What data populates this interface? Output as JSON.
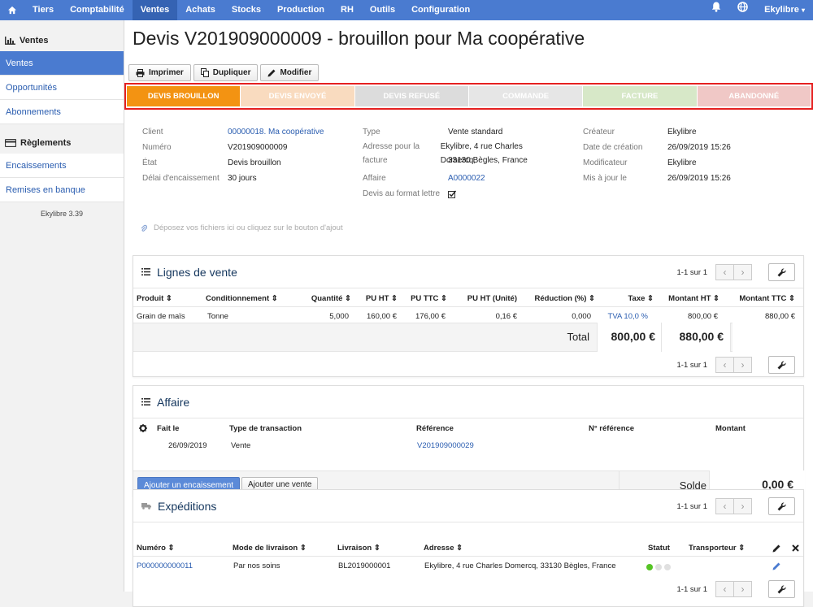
{
  "topbar": {
    "items": [
      "Tiers",
      "Comptabilité",
      "Ventes",
      "Achats",
      "Stocks",
      "Production",
      "RH",
      "Outils",
      "Configuration"
    ],
    "user": "Ekylibre"
  },
  "sidebar": {
    "section1": "Ventes",
    "items1": [
      "Ventes",
      "Opportunités",
      "Abonnements"
    ],
    "section2": "Règlements",
    "items2": [
      "Encaissements",
      "Remises en banque"
    ],
    "version": "Ekylibre 3.39"
  },
  "page": {
    "title": "Devis V201909000009 - brouillon pour Ma coopérative",
    "buttons": [
      "Imprimer",
      "Dupliquer",
      "Modifier"
    ]
  },
  "stages": [
    {
      "label": "DEVIS BROUILLON",
      "color": "#f39312"
    },
    {
      "label": "DEVIS ENVOYÉ",
      "color": "#f9dbbf"
    },
    {
      "label": "DEVIS REFUSÉ",
      "color": "#dcdcdc"
    },
    {
      "label": "COMMANDE",
      "color": "#e6e6e6"
    },
    {
      "label": "FACTURE",
      "color": "#d7e8c8"
    },
    {
      "label": "ABANDONNÉ",
      "color": "#f0c8c6"
    }
  ],
  "info": {
    "col1": [
      {
        "label": "Client",
        "value": "00000018. Ma coopérative"
      },
      {
        "label": "Numéro",
        "value": "V201909000009"
      },
      {
        "label": "État",
        "value": "Devis brouillon"
      },
      {
        "label": "Délai d'encaissement",
        "value": "30 jours"
      }
    ],
    "col2": {
      "type_label": "Type",
      "type_value": "Vente standard",
      "address_label": "Adresse pour la facture",
      "address_line1": "Ekylibre, 4 rue Charles Domercq,",
      "address_line2": "33130 Bègles, France",
      "affaire_label": "Affaire",
      "affaire_value": "A0000022",
      "lettre_label": "Devis au format lettre"
    },
    "col3": [
      {
        "label": "Créateur",
        "value": "Ekylibre"
      },
      {
        "label": "Date de création",
        "value": "26/09/2019 15:26"
      },
      {
        "label": "Modificateur",
        "value": "Ekylibre"
      },
      {
        "label": "Mis à jour le",
        "value": "26/09/2019 15:26"
      }
    ]
  },
  "dropzone": "Déposez vos fichiers ici ou cliquez sur le bouton d'ajout",
  "lignes": {
    "title": "Lignes de vente",
    "pager": "1-1 sur 1",
    "headers": [
      "Produit ⇕",
      "Conditionnement ⇕",
      "Quantité ⇕",
      "PU HT ⇕",
      "PU TTC ⇕",
      "PU HT (Unité)",
      "Réduction (%) ⇕",
      "Taxe ⇕",
      "Montant HT ⇕",
      "Montant TTC ⇕"
    ],
    "row": [
      "Grain de maïs",
      "Tonne",
      "5,000",
      "160,00 €",
      "176,00 €",
      "0,16 €",
      "0,000",
      "TVA 10,0 %",
      "800,00 €",
      "880,00 €"
    ],
    "total_label": "Total",
    "total_ht": "800,00 €",
    "total_ttc": "880,00 €"
  },
  "affaire": {
    "title": "Affaire",
    "headers": [
      "Fait le",
      "Type de transaction",
      "Référence",
      "N° référence",
      "Montant"
    ],
    "row": [
      "26/09/2019",
      "Vente",
      "V201909000029"
    ],
    "btn_encaissement": "Ajouter un encaissement",
    "btn_vente": "Ajouter une vente",
    "solde_label": "Solde",
    "solde_value": "0,00 €"
  },
  "expeditions": {
    "title": "Expéditions",
    "pager": "1-1 sur 1",
    "headers": [
      "Numéro ⇕",
      "Mode de livraison ⇕",
      "Livraison ⇕",
      "Adresse ⇕",
      "Statut",
      "Transporteur ⇕"
    ],
    "row": [
      "P000000000011",
      "Par nos soins",
      "BL2019000001",
      "Ekylibre, 4 rue Charles Domercq, 33130 Bègles, France"
    ]
  }
}
